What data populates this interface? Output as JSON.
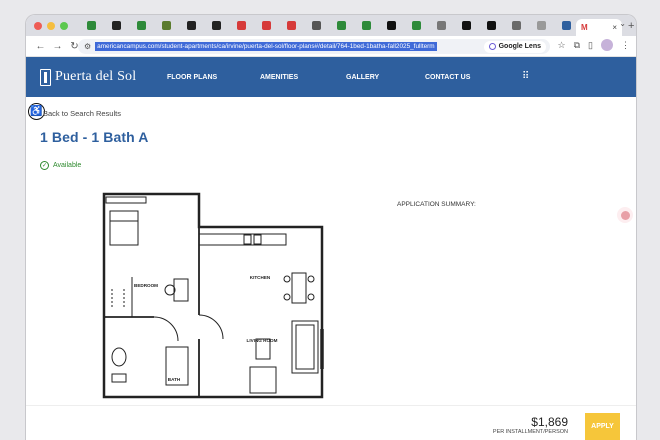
{
  "browser": {
    "url": "americancampus.com/student-apartments/ca/irvine/puerta-del-sol/floor-plans#/detail/764-1bed-1batha-fall2025_fullterm",
    "lens_label": "Google Lens",
    "new_tab": "+",
    "active_tab_close": "×",
    "tab_favicon_colors": [
      "#2e8a3a",
      "#222222",
      "#2e8a3a",
      "#5a7b2e",
      "#222222",
      "#222222",
      "#d63a3a",
      "#d63a3a",
      "#d63a3a",
      "#555555",
      "#2e8a3a",
      "#2e8a3a",
      "#111111",
      "#2e8a3a",
      "#777777",
      "#111111",
      "#111111",
      "#6a6a6a",
      "#999999",
      "#2e5f9e"
    ]
  },
  "site": {
    "brand": "Puerta del Sol",
    "nav": [
      "FLOOR PLANS",
      "AMENITIES",
      "GALLERY",
      "CONTACT US"
    ]
  },
  "content": {
    "back_link": "Back to Search Results",
    "title": "1 Bed - 1 Bath A",
    "availability": "Available",
    "application_summary": "APPLICATION SUMMARY:"
  },
  "floorplan": {
    "rooms": [
      "BEDROOM",
      "KITCHEN",
      "LIVING ROOM",
      "BATH"
    ]
  },
  "pricing": {
    "amount": "$1,869",
    "period": "PER INSTALLMENT/PERSON",
    "apply_label": "APPLY"
  },
  "colors": {
    "brand_blue": "#2e5f9e",
    "available_green": "#2e8a2e",
    "apply_yellow": "#f6c63a"
  }
}
